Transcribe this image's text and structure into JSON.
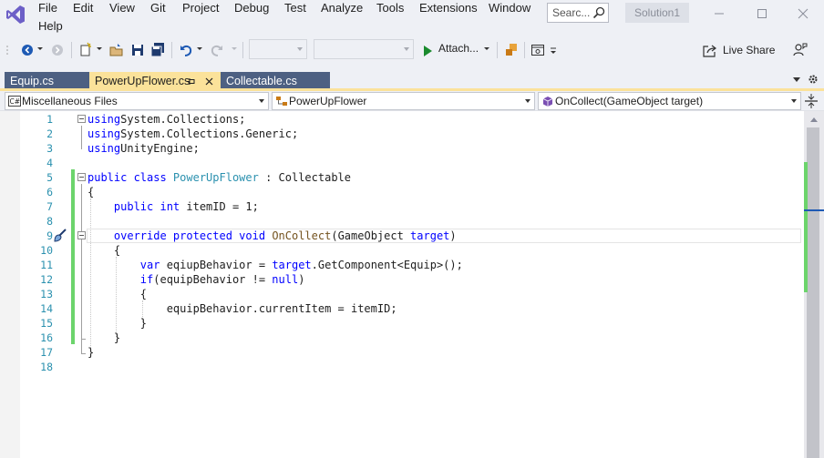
{
  "menu": {
    "items": [
      "File",
      "Edit",
      "View",
      "Git",
      "Project",
      "Debug",
      "Test",
      "Analyze",
      "Tools",
      "Extensions",
      "Window",
      "Help"
    ]
  },
  "search": {
    "placeholder": "Searc..."
  },
  "solution_name": "Solution1",
  "toolbar": {
    "attach_label": "Attach...",
    "live_share_label": "Live Share"
  },
  "tabs": [
    {
      "label": "Equip.cs",
      "active": false
    },
    {
      "label": "PowerUpFlower.cs",
      "active": true
    },
    {
      "label": "Collectable.cs",
      "active": false
    }
  ],
  "navbar": {
    "project": "Miscellaneous Files",
    "type": "PowerUpFlower",
    "member": "OnCollect(GameObject target)"
  },
  "editor": {
    "line_numbers": [
      "1",
      "2",
      "3",
      "4",
      "5",
      "6",
      "7",
      "8",
      "9",
      "10",
      "11",
      "12",
      "13",
      "14",
      "15",
      "16",
      "17",
      "18"
    ],
    "lines": [
      [
        [
          "kw",
          "using"
        ],
        [
          "",
          "System.Collections;"
        ]
      ],
      [
        [
          "kw",
          "using"
        ],
        [
          "",
          "System.Collections.Generic;"
        ]
      ],
      [
        [
          "kw",
          "using"
        ],
        [
          "",
          "UnityEngine;"
        ]
      ],
      [],
      [
        [
          "kw",
          "public class "
        ],
        [
          "ty",
          "PowerUpFlower"
        ],
        [
          "",
          " : Collectable"
        ]
      ],
      [
        [
          "",
          "{"
        ]
      ],
      [
        [
          "",
          "    "
        ],
        [
          "kw",
          "public int"
        ],
        [
          "",
          " itemID = 1;"
        ]
      ],
      [],
      [
        [
          "",
          "    "
        ],
        [
          "kw",
          "override protected void"
        ],
        [
          "",
          " "
        ],
        [
          "mt",
          "OnCollect"
        ],
        [
          "",
          "(GameObject "
        ],
        [
          "kw",
          "target"
        ],
        [
          "",
          ")"
        ]
      ],
      [
        [
          "",
          "    {"
        ]
      ],
      [
        [
          "",
          "        "
        ],
        [
          "kw",
          "var"
        ],
        [
          "",
          " eqiupBehavior = "
        ],
        [
          "kw",
          "target"
        ],
        [
          "",
          ".GetComponent<Equip>();"
        ]
      ],
      [
        [
          "",
          "        "
        ],
        [
          "kw",
          "if"
        ],
        [
          "",
          "(equipBehavior != "
        ],
        [
          "kw",
          "null"
        ],
        [
          "",
          ")"
        ]
      ],
      [
        [
          "",
          "        {"
        ]
      ],
      [
        [
          "",
          "            equipBehavior.currentItem = itemID;"
        ]
      ],
      [
        [
          "",
          "        }"
        ]
      ],
      [
        [
          "",
          "    }"
        ]
      ],
      [
        [
          "",
          "}"
        ]
      ],
      []
    ]
  },
  "colors": {
    "active_tab": "#fbe29a",
    "inactive_tab": "#4d6082",
    "keyword": "#0000ff",
    "type_name": "#2b91af",
    "method_name": "#74531f",
    "change_marker": "#6cd46c"
  }
}
